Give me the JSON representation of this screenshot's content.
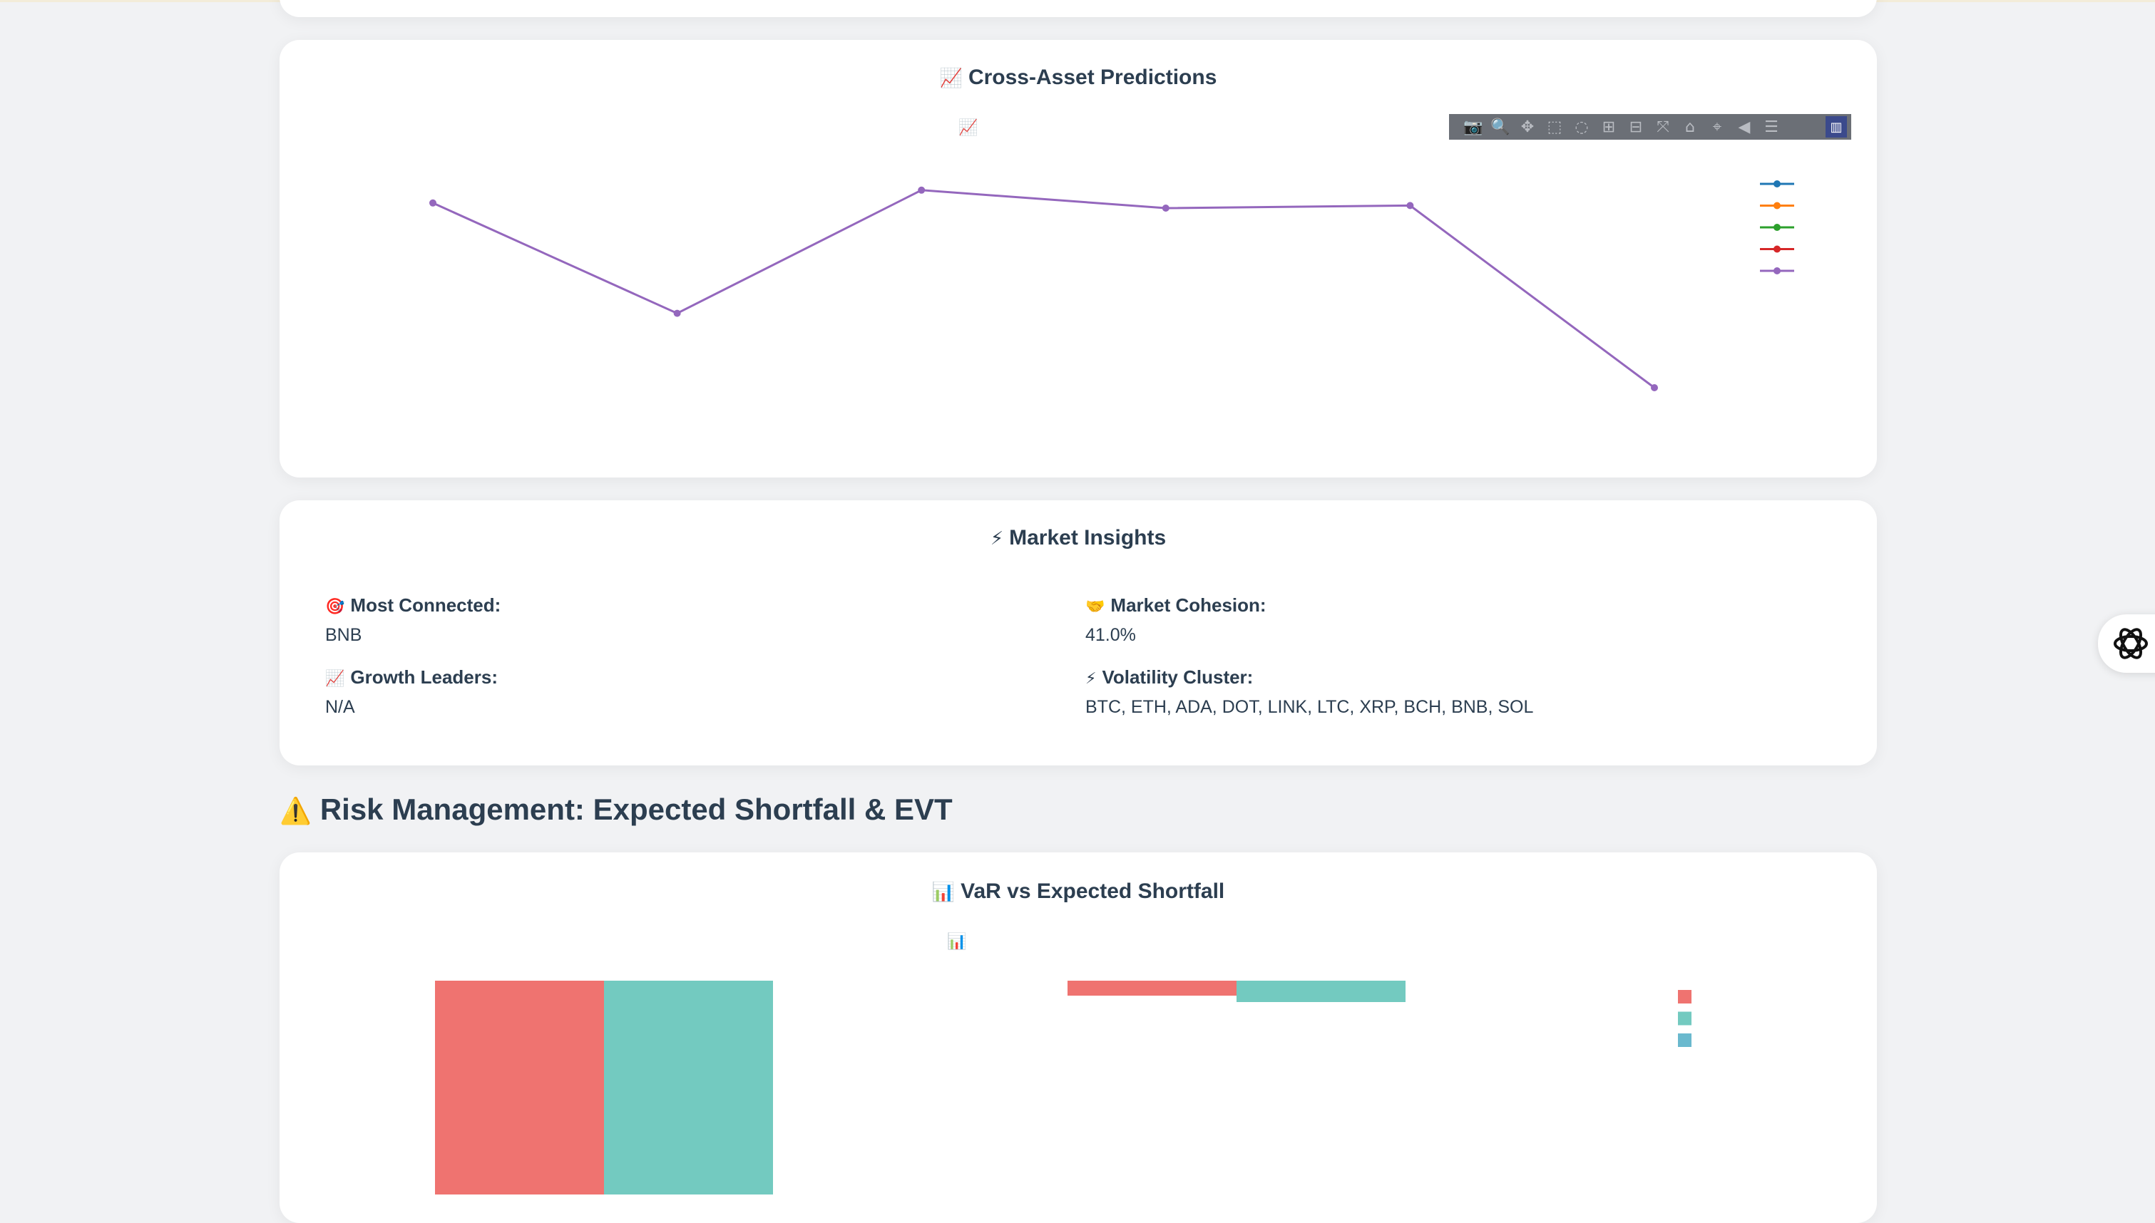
{
  "cross_asset": {
    "title": "Cross-Asset Predictions",
    "title_icon": "📈",
    "chart_icon": "📈",
    "toolbar": [
      {
        "name": "camera-icon",
        "glyph": "📷"
      },
      {
        "name": "zoom-icon",
        "glyph": "🔍"
      },
      {
        "name": "pan-icon",
        "glyph": "✥"
      },
      {
        "name": "box-select-icon",
        "glyph": "⬚"
      },
      {
        "name": "lasso-select-icon",
        "glyph": "◌"
      },
      {
        "name": "zoom-in-icon",
        "glyph": "⊞"
      },
      {
        "name": "zoom-out-icon",
        "glyph": "⊟"
      },
      {
        "name": "autoscale-icon",
        "glyph": "⤧"
      },
      {
        "name": "reset-axes-icon",
        "glyph": "⌂"
      },
      {
        "name": "spike-lines-icon",
        "glyph": "⌖"
      },
      {
        "name": "hover-closest-icon",
        "glyph": "◀"
      },
      {
        "name": "hover-compare-icon",
        "glyph": "☰"
      }
    ],
    "legend_colors": [
      "#1f77b4",
      "#ff7f0e",
      "#2ca02c",
      "#d62728",
      "#9467bd"
    ]
  },
  "chart_data": [
    {
      "type": "line",
      "title": "",
      "series": [
        {
          "color": "#9467bd",
          "values": [
            0.82,
            0.39,
            0.87,
            0.8,
            0.81,
            0.1
          ]
        }
      ]
    },
    {
      "type": "bar",
      "title": "",
      "categories": [
        "",
        ""
      ],
      "series": [
        {
          "color": "#ef7370",
          "values": [
            1.0,
            0.07
          ]
        },
        {
          "color": "#73cac0",
          "values": [
            1.0,
            0.1
          ]
        }
      ],
      "legend_colors": [
        "#ef7370",
        "#73cac0",
        "#6ab9ce"
      ]
    }
  ],
  "insights": {
    "title": "Market Insights",
    "title_icon": "⚡",
    "most_connected": {
      "icon": "🎯",
      "label": "Most Connected:",
      "value": "BNB"
    },
    "market_cohesion": {
      "icon": "🤝",
      "label": "Market Cohesion:",
      "value": "41.0%"
    },
    "growth_leaders": {
      "icon": "📈",
      "label": "Growth Leaders:",
      "value": "N/A"
    },
    "volatility_cluster": {
      "icon": "⚡",
      "label": "Volatility Cluster:",
      "value": "BTC, ETH, ADA, DOT, LINK, LTC, XRP, BCH, BNB, SOL"
    }
  },
  "risk": {
    "heading": "Risk Management: Expected Shortfall & EVT",
    "heading_icon": "⚠️",
    "card_title": "VaR vs Expected Shortfall",
    "card_icon": "📊",
    "chart_icon": "📊"
  }
}
